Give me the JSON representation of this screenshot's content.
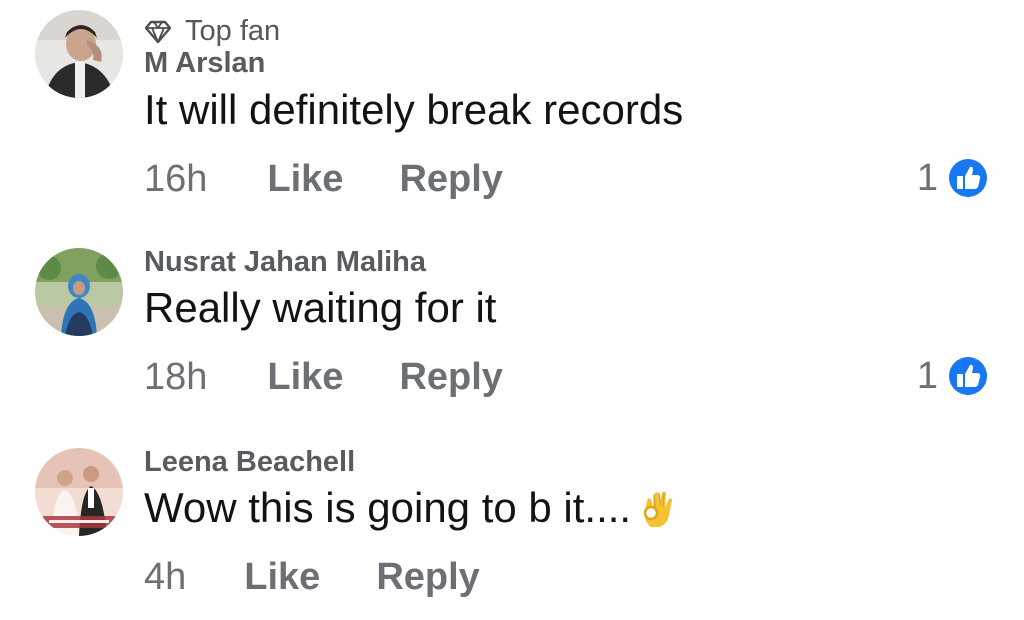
{
  "comments": [
    {
      "badge": "Top fan",
      "badge_icon": "diamond-icon",
      "author": "M Arslan",
      "text": "It will definitely break records",
      "time": "16h",
      "like_label": "Like",
      "reply_label": "Reply",
      "reaction_count": "1",
      "reaction_icon": "thumbs-up-icon"
    },
    {
      "author": "Nusrat Jahan Maliha",
      "text": "Really waiting for it",
      "time": "18h",
      "like_label": "Like",
      "reply_label": "Reply",
      "reaction_count": "1",
      "reaction_icon": "thumbs-up-icon"
    },
    {
      "author": "Leena Beachell",
      "text": "Wow this is going to b it....",
      "emoji": "ok-hand-emoji",
      "time": "4h",
      "like_label": "Like",
      "reply_label": "Reply"
    }
  ],
  "colors": {
    "reaction_blue": "#1877f2",
    "meta_gray": "#6c7075"
  }
}
